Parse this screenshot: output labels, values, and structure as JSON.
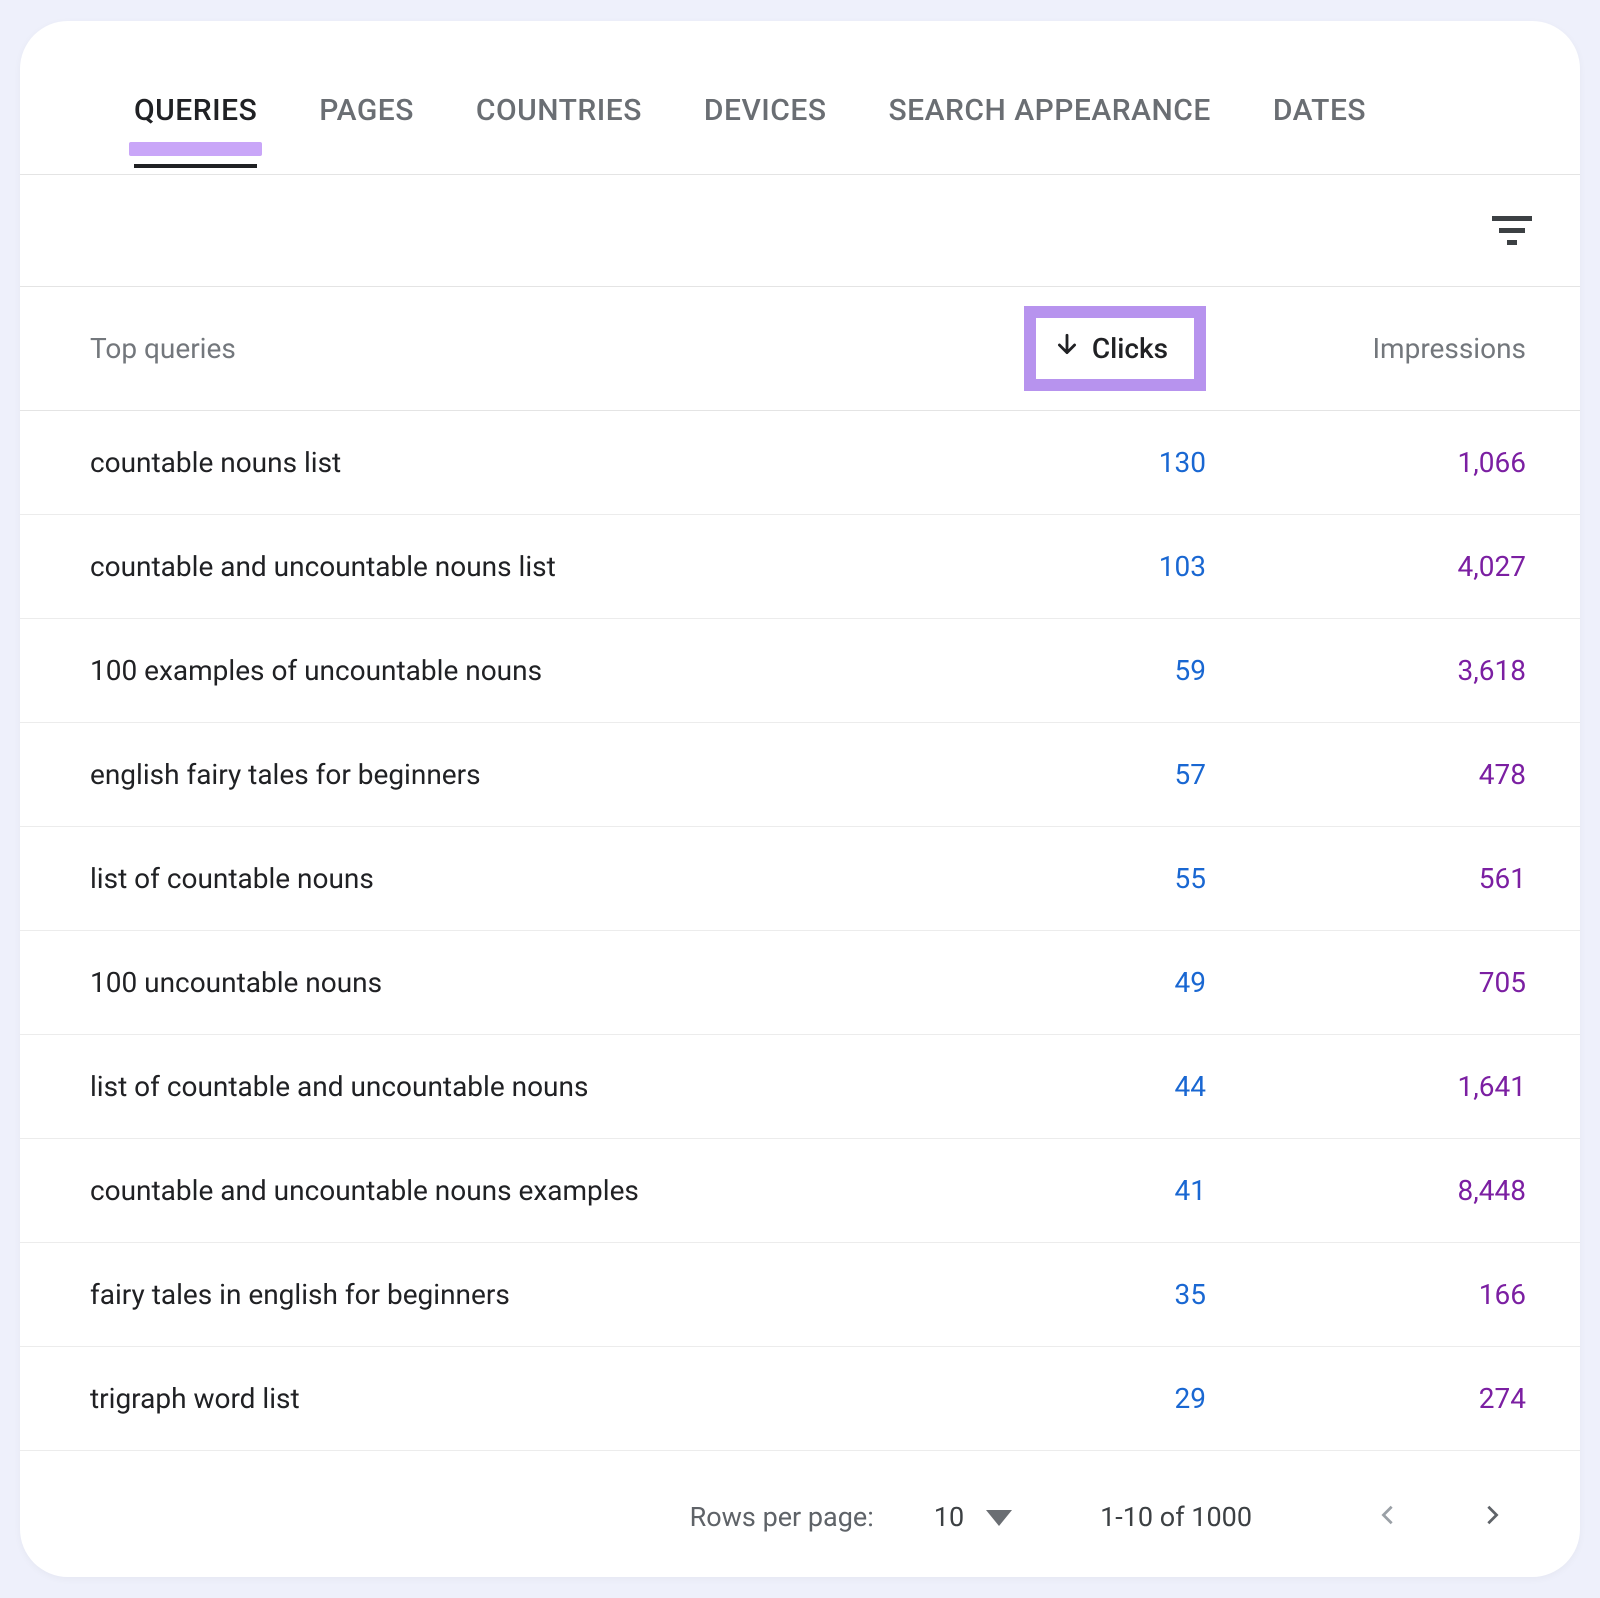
{
  "tabs": [
    {
      "label": "QUERIES",
      "active": true
    },
    {
      "label": "PAGES"
    },
    {
      "label": "COUNTRIES"
    },
    {
      "label": "DEVICES"
    },
    {
      "label": "SEARCH APPEARANCE"
    },
    {
      "label": "DATES"
    }
  ],
  "columns": {
    "topQueries": "Top queries",
    "clicks": "Clicks",
    "impressions": "Impressions"
  },
  "sort": {
    "column": "clicks",
    "direction": "desc"
  },
  "rows": [
    {
      "query": "countable nouns list",
      "clicks": "130",
      "impressions": "1,066"
    },
    {
      "query": "countable and uncountable nouns list",
      "clicks": "103",
      "impressions": "4,027"
    },
    {
      "query": "100 examples of uncountable nouns",
      "clicks": "59",
      "impressions": "3,618"
    },
    {
      "query": "english fairy tales for beginners",
      "clicks": "57",
      "impressions": "478"
    },
    {
      "query": "list of countable nouns",
      "clicks": "55",
      "impressions": "561"
    },
    {
      "query": "100 uncountable nouns",
      "clicks": "49",
      "impressions": "705"
    },
    {
      "query": "list of countable and uncountable nouns",
      "clicks": "44",
      "impressions": "1,641"
    },
    {
      "query": "countable and uncountable nouns examples",
      "clicks": "41",
      "impressions": "8,448"
    },
    {
      "query": "fairy tales in english for beginners",
      "clicks": "35",
      "impressions": "166"
    },
    {
      "query": "trigraph word list",
      "clicks": "29",
      "impressions": "274"
    }
  ],
  "pagination": {
    "rowsPerPageLabel": "Rows per page:",
    "rowsPerPageValue": "10",
    "range": "1-10 of 1000"
  },
  "icons": {
    "filter": "filter-icon",
    "sortDesc": "arrow-down-icon",
    "dropdown": "chevron-down-icon",
    "prev": "chevron-left-icon",
    "next": "chevron-right-icon"
  },
  "colors": {
    "highlightBorder": "#b793ee",
    "clicks": "#1967d2",
    "impressions": "#7b1fa2"
  }
}
